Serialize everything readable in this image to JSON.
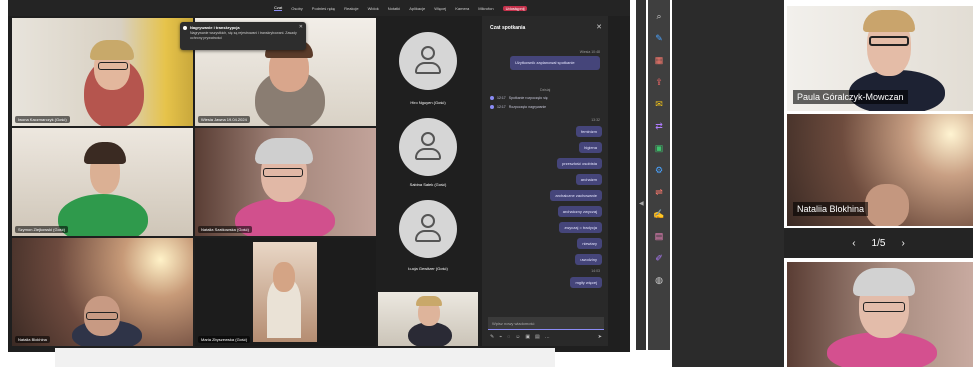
{
  "topbar": {
    "tabs": [
      "Czat",
      "Osoby",
      "Podnieś rękę",
      "Reakcje",
      "Widok",
      "Notatki",
      "Aplikacje",
      "Więcej",
      "Kamera",
      "Mikrofon",
      "Udostępnij"
    ]
  },
  "toast": {
    "title": "Nagrywanie i transkrypcja",
    "body": "Nagrywanie wszystkich, się są rejestrowani i transkrybowani. Zasady ochrony prywatności"
  },
  "participants": [
    {
      "name": "Iwona Kaczmarczyk (Gość)"
    },
    {
      "name": "Wiesia Jawna 19.04.2024"
    },
    {
      "name": "Hiro Nguyen (Gość)"
    },
    {
      "name": "Szymon Ziejkowski (Gość)"
    },
    {
      "name": "Natalia Szatkowska (Gość)"
    },
    {
      "name": "Sabina Sałek (Gość)"
    },
    {
      "name": "Natalia Blokhina"
    },
    {
      "name": "Maria Zbyszewska (Gość)"
    },
    {
      "name": "Łucja Gewitzer (Gość)"
    }
  ],
  "chat": {
    "title": "Czat spotkania",
    "organizer": "Wiesia 10:48",
    "first_message": "Użytkownik zaplanował spotkanie",
    "day_label": "Dzisiaj",
    "system": [
      {
        "time": "12:17",
        "text": "Spotkanie rozpoczęło się"
      },
      {
        "time": "12:17",
        "text": "Rozpoczęto nagrywanie"
      }
    ],
    "time_a": "13:32",
    "words": [
      "feminizm",
      "higiena",
      "przeszłość osobista",
      "archaizm",
      "archaiczne zachowanie",
      "archaiczny zwyczaj",
      "zwyczaj = tradycja",
      "niewiary",
      "uwodziny"
    ],
    "time_b": "14:03",
    "last": "mgiły więcej",
    "input_placeholder": "Wpisz nowy wiadomość"
  },
  "tools": [
    "search-icon",
    "edit-icon",
    "layout-icon",
    "export-icon",
    "comment-icon",
    "share-icon",
    "compress-icon",
    "settings-icon",
    "convert-icon",
    "sign-icon",
    "pdf-icon",
    "pen-icon",
    "fill-icon"
  ],
  "right": {
    "names": [
      "Paula Góralczyk-Mowczan",
      "Nataliia Blokhina"
    ],
    "page": "1/5"
  }
}
